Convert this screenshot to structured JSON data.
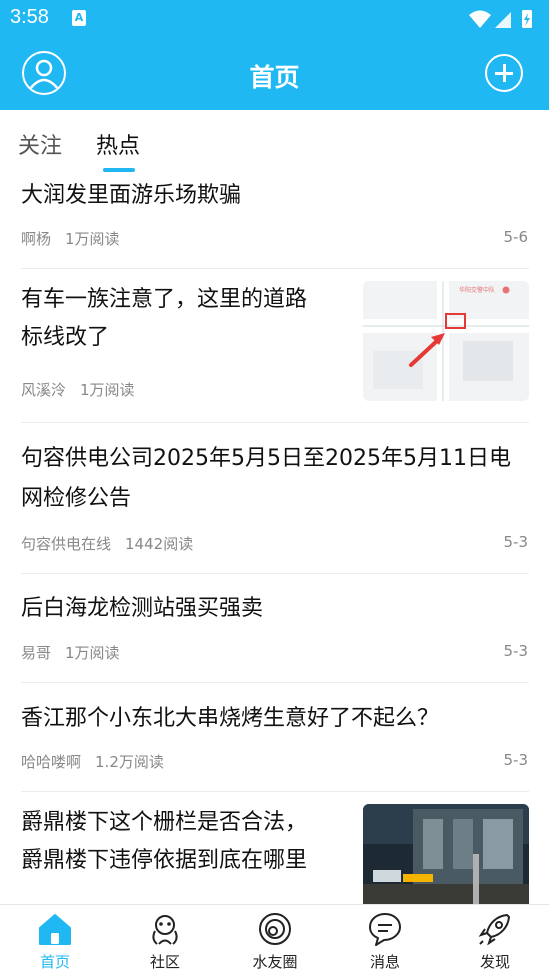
{
  "status_bar": {
    "time": "3:58",
    "notification_badge": "A"
  },
  "header": {
    "title": "首页"
  },
  "tabs": [
    {
      "label": "关注"
    },
    {
      "label": "热点"
    }
  ],
  "feed": [
    {
      "title": "大润发里面游乐场欺骗",
      "author": "啊杨",
      "reads": "1万阅读",
      "date": "5-6"
    },
    {
      "title_line1": "有车一族注意了，这里的道路",
      "title_line2": "标线改了",
      "author": "风溪泠",
      "reads": "1万阅读",
      "map_labels": [
        "华阳交警中队"
      ]
    },
    {
      "title_line1": "句容供电公司2025年5月5日至2025年5月11日电",
      "title_line2": "网检修公告",
      "author": "句容供电在线",
      "reads": "1442阅读",
      "date": "5-3"
    },
    {
      "title": "后白海龙检测站强买强卖",
      "author": "易哥",
      "reads": "1万阅读",
      "date": "5-3"
    },
    {
      "title": "香江那个小东北大串烧烤生意好了不起么？",
      "author": "哈哈喽啊",
      "reads": "1.2万阅读",
      "date": "5-3"
    },
    {
      "title_line1": "爵鼎楼下这个栅栏是否合法，",
      "title_line2": "爵鼎楼下违停依据到底在哪里"
    }
  ],
  "bottom_nav": [
    {
      "label": "首页",
      "icon": "home-icon",
      "active": true
    },
    {
      "label": "社区",
      "icon": "community-icon",
      "active": false
    },
    {
      "label": "水友圈",
      "icon": "circle-icon",
      "active": false
    },
    {
      "label": "消息",
      "icon": "message-icon",
      "active": false
    },
    {
      "label": "发现",
      "icon": "rocket-icon",
      "active": false
    }
  ],
  "colors": {
    "brand": "#1fb8f2",
    "text": "#111111",
    "meta": "#888888"
  }
}
